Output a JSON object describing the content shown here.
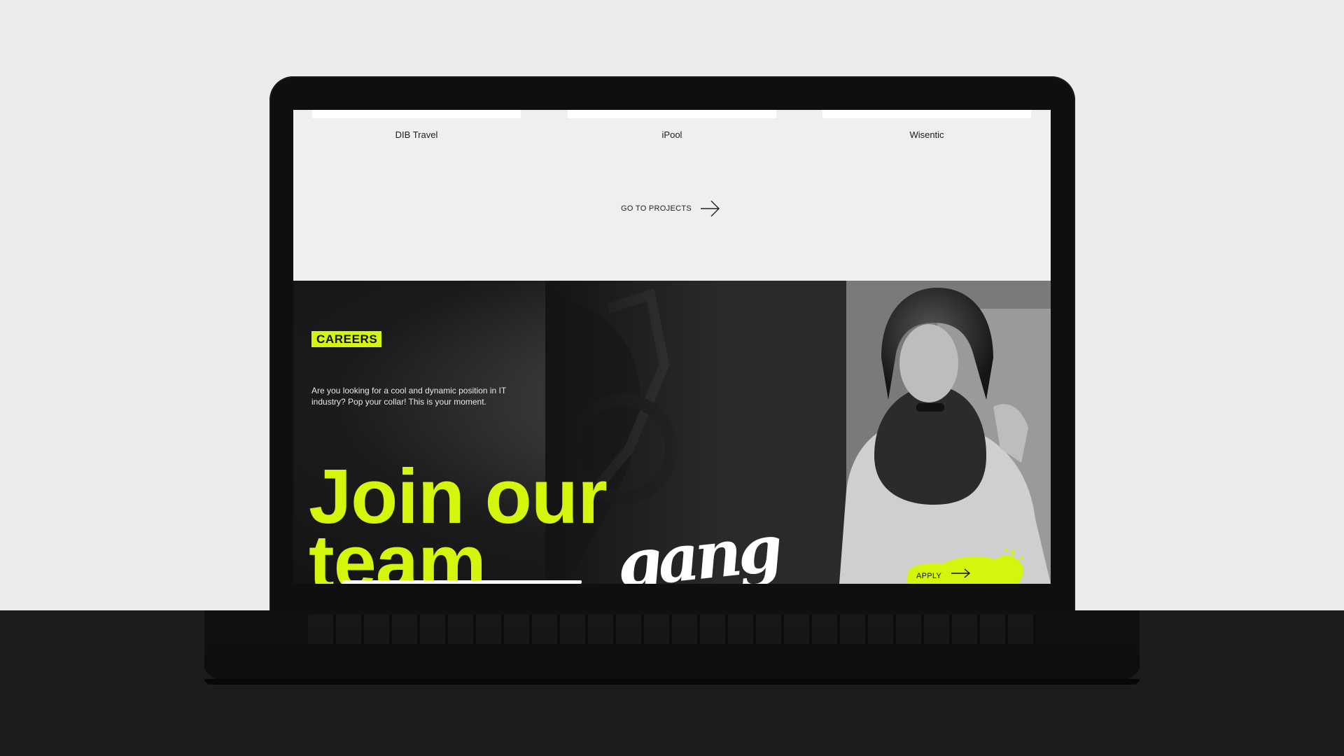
{
  "projects": {
    "items": [
      {
        "name": "DIB Travel"
      },
      {
        "name": "iPool"
      },
      {
        "name": "Wisentic"
      }
    ],
    "go_projects_label": "GO TO PROJECTS"
  },
  "careers": {
    "tag": "CAREERS",
    "description": "Are you looking for a cool and dynamic position in IT industry? Pop your collar! This is your moment.",
    "headline_line1": "Join our",
    "headline_line2": "team",
    "headline_script": "gang",
    "apply_label": "APPLY"
  },
  "colors": {
    "accent": "#d4f50c",
    "dark_bg": "#141415",
    "light_bg": "#efefef",
    "desk": "#1c1c1e"
  }
}
